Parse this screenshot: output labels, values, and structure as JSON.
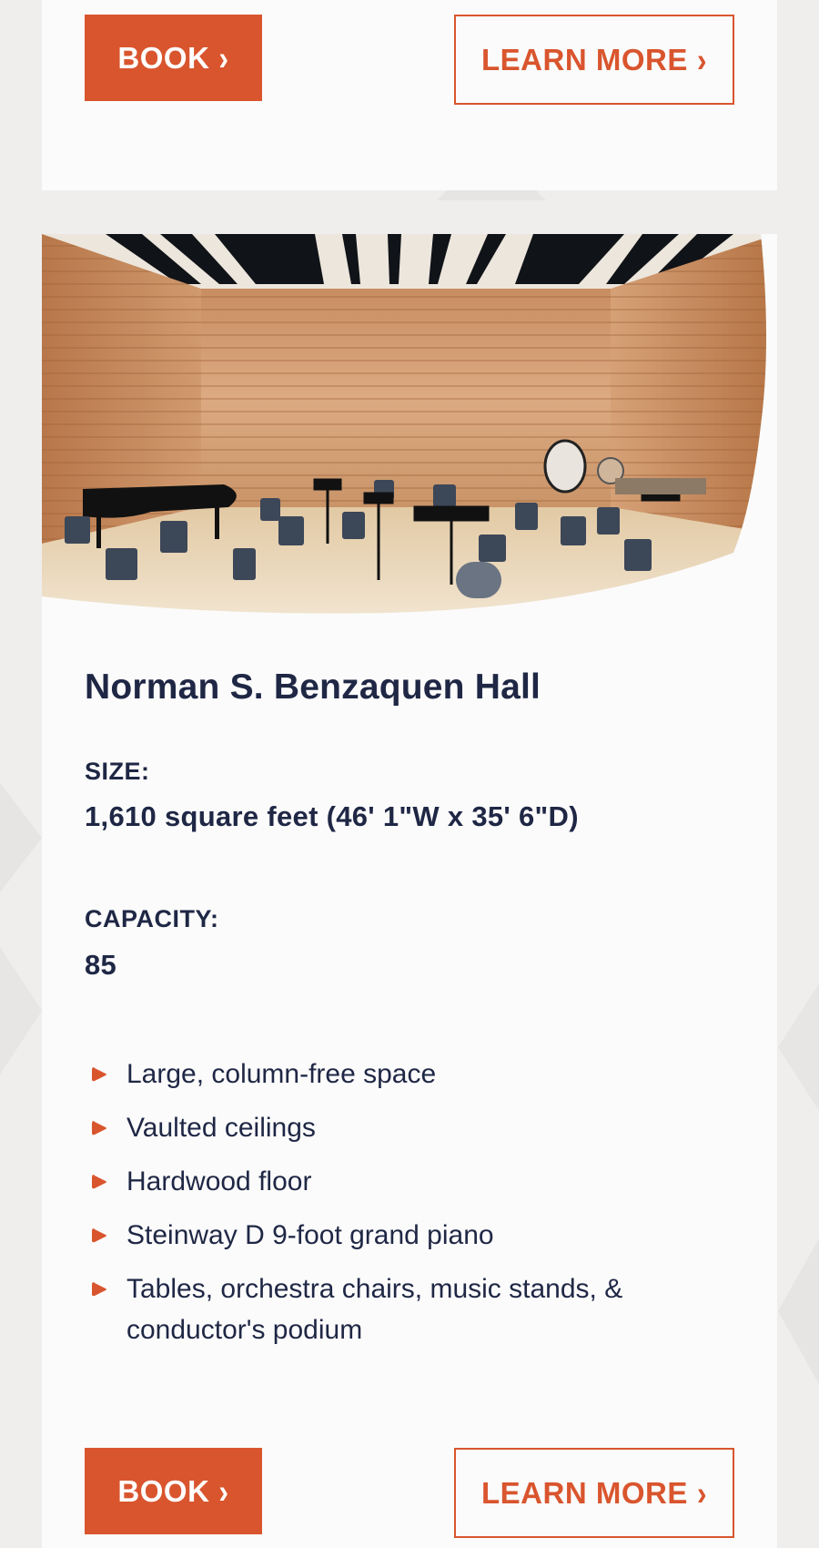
{
  "top_card": {
    "book_label": "BOOK",
    "learn_more_label": "LEARN MORE"
  },
  "hall": {
    "image_alt": "Norman S. Benzaquen Hall rehearsal room with piano, chairs and music stands",
    "title": "Norman S. Benzaquen Hall",
    "size_label": "SIZE:",
    "size_value": "1,610 square feet (46' 1\"W x 35' 6\"D)",
    "capacity_label": "CAPACITY:",
    "capacity_value": "85",
    "features": [
      "Large, column-free space",
      "Vaulted ceilings",
      "Hardwood floor",
      "Steinway D 9-foot grand piano",
      "Tables, orchestra chairs, music stands, & conductor's podium"
    ],
    "book_label": "BOOK",
    "learn_more_label": "LEARN MORE"
  },
  "icons": {
    "chevron": "chevron-right-icon",
    "bullet": "triangle-bullet-icon"
  },
  "colors": {
    "accent": "#d9552e",
    "text": "#1f2745",
    "page_background": "#efeeed",
    "card_background": "#fbfbfb"
  }
}
